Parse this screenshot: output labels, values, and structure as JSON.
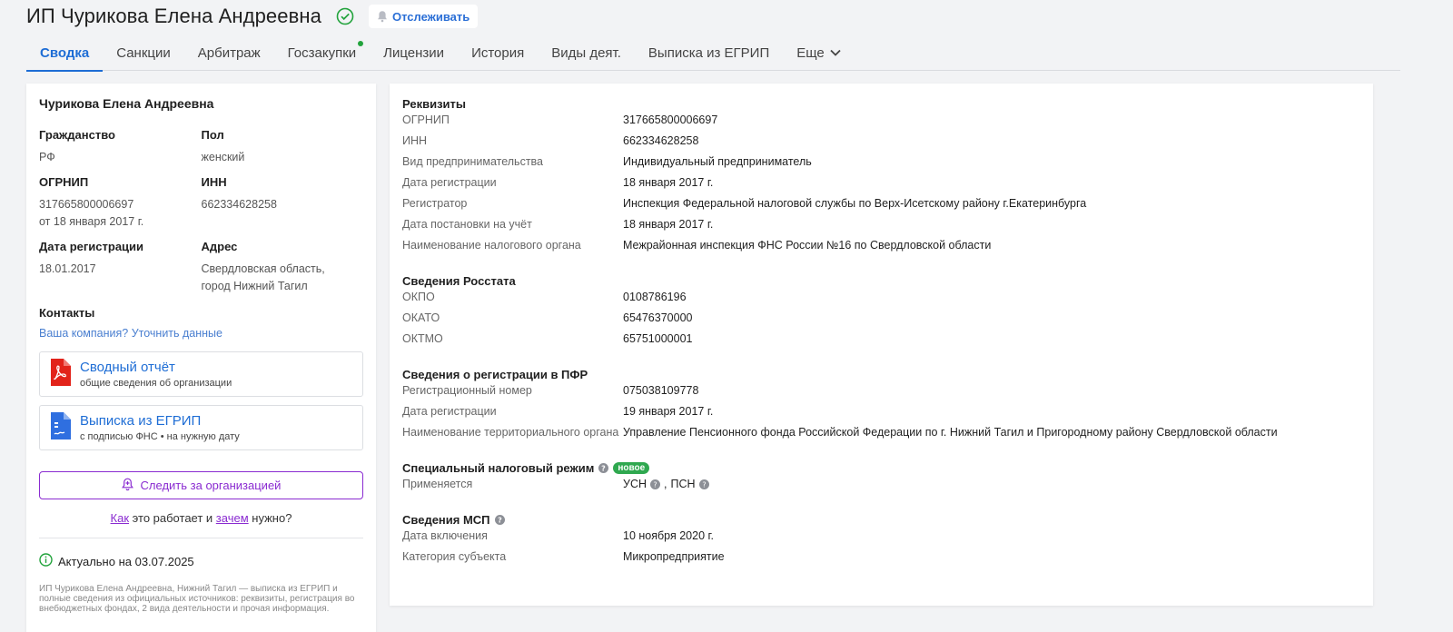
{
  "header": {
    "title": "ИП Чурикова Елена Андреевна",
    "track_label": "Отслеживать"
  },
  "tabs": [
    {
      "label": "Сводка"
    },
    {
      "label": "Санкции"
    },
    {
      "label": "Арбитраж"
    },
    {
      "label": "Госзакупки"
    },
    {
      "label": "Лицензии"
    },
    {
      "label": "История"
    },
    {
      "label": "Виды деят."
    },
    {
      "label": "Выписка из ЕГРИП"
    },
    {
      "label": "Еще"
    }
  ],
  "left": {
    "name": "Чурикова Елена Андреевна",
    "citizenship_label": "Гражданство",
    "citizenship_value": "РФ",
    "sex_label": "Пол",
    "sex_value": "женский",
    "ogrnip_label": "ОГРНИП",
    "ogrnip_value": "317665800006697",
    "ogrnip_date": "от 18 января 2017 г.",
    "inn_label": "ИНН",
    "inn_value": "662334628258",
    "regdate_label": "Дата регистрации",
    "regdate_value": "18.01.2017",
    "address_label": "Адрес",
    "address_line1": "Свердловская область,",
    "address_line2": "город Нижний Тагил",
    "contacts_label": "Контакты",
    "contacts_link": "Ваша компания? Уточнить данные",
    "report_title": "Сводный отчёт",
    "report_sub": "общие сведения об организации",
    "egrip_title": "Выписка из ЕГРИП",
    "egrip_sub": "с подписью ФНС • на нужную дату",
    "follow_label": "Следить за организацией",
    "how_1": "Как",
    "how_2": " это работает и ",
    "how_3": "зачем",
    "how_4": " нужно?",
    "actual": "Актуально на 03.07.2025",
    "desc": "ИП Чурикова Елена Андреевна, Нижний Тагил — выписка из ЕГРИП и полные сведения из официальных источников: реквизиты, регистрация во внебюджетных фондах, 2 вида деятельности и прочая информация."
  },
  "right": {
    "rekv_title": "Реквизиты",
    "rekv": [
      {
        "k": "ОГРНИП",
        "v": "317665800006697"
      },
      {
        "k": "ИНН",
        "v": "662334628258"
      },
      {
        "k": "Вид предпринимательства",
        "v": "Индивидуальный предприниматель"
      },
      {
        "k": "Дата регистрации",
        "v": "18 января 2017 г."
      },
      {
        "k": "Регистратор",
        "v": "Инспекция Федеральной налоговой службы по Верх-Исетскому району г.Екатеринбурга"
      },
      {
        "k": "Дата постановки на учёт",
        "v": "18 января 2017 г."
      },
      {
        "k": "Наименование налогового органа",
        "v": "Межрайонная инспекция ФНС России №16 по Свердловской области"
      }
    ],
    "rosstat_title": "Сведения Росстата",
    "rosstat": [
      {
        "k": "ОКПО",
        "v": "0108786196"
      },
      {
        "k": "ОКАТО",
        "v": "65476370000"
      },
      {
        "k": "ОКТМО",
        "v": "65751000001"
      }
    ],
    "pfr_title": "Сведения о регистрации в ПФР",
    "pfr": [
      {
        "k": "Регистрационный номер",
        "v": "075038109778"
      },
      {
        "k": "Дата регистрации",
        "v": "19 января 2017 г."
      },
      {
        "k": "Наименование территориального органа",
        "v": "Управление Пенсионного фонда Российской Федерации по г. Нижний Тагил и Пригородному району Свердловской области"
      }
    ],
    "tax_title": "Специальный налоговый режим",
    "tax_badge": "новое",
    "tax_key": "Применяется",
    "tax_v1": "УСН",
    "tax_v2": "ПСН",
    "msp_title": "Сведения МСП",
    "msp": [
      {
        "k": "Дата включения",
        "v": "10 ноября 2020 г."
      },
      {
        "k": "Категория субъекта",
        "v": "Микропредприятие"
      }
    ]
  },
  "colors": {
    "accent": "#1e6dd5",
    "purple": "#8a2bd1",
    "green": "#22a33c"
  }
}
